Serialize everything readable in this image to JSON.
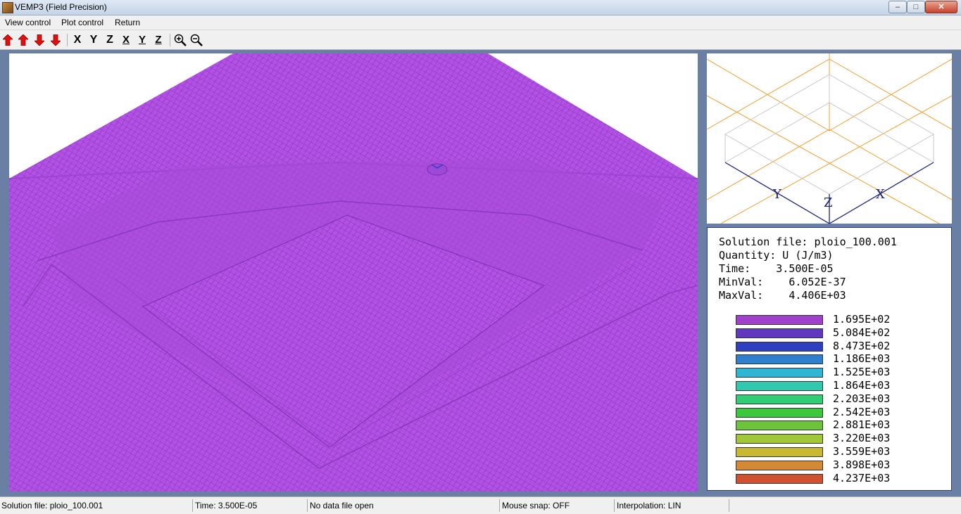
{
  "window": {
    "title": "VEMP3 (Field Precision)",
    "controls": [
      "–",
      "□",
      "✕"
    ]
  },
  "menu": {
    "items": [
      "View control",
      "Plot control",
      "Return"
    ]
  },
  "toolbar": {
    "arrows": [
      "up-arrow-icon",
      "up-arrow-icon",
      "down-arrow-icon",
      "down-arrow-icon"
    ],
    "axis_letters": [
      "X",
      "Y",
      "Z"
    ],
    "axis_sub_letters": [
      "X",
      "Y",
      "Z"
    ],
    "zoom_icons": [
      "zoom-in-icon",
      "zoom-out-icon"
    ],
    "arrow_color": "#e01010"
  },
  "orientation": {
    "axis_x": "X",
    "axis_y": "Y",
    "axis_z": "Z",
    "box_color": "#cccccc",
    "plane_color": "#f0a030",
    "axis_color": "#1a237e"
  },
  "info": {
    "solution_file": "Solution file: ploio_100.001",
    "quantity": "Quantity: U (J/m3)",
    "time": "Time:    3.500E-05",
    "min_val": "MinVal:    6.052E-37",
    "max_val": "MaxVal:    4.406E+03"
  },
  "legend": [
    {
      "label": "1.695E+02",
      "color": "#a040cc"
    },
    {
      "label": "5.084E+02",
      "color": "#6038c0"
    },
    {
      "label": "8.473E+02",
      "color": "#2e3fc0"
    },
    {
      "label": "1.186E+03",
      "color": "#2f7fd0"
    },
    {
      "label": "1.525E+03",
      "color": "#2fb6d4"
    },
    {
      "label": "1.864E+03",
      "color": "#2fc9b0"
    },
    {
      "label": "2.203E+03",
      "color": "#33cc77"
    },
    {
      "label": "2.542E+03",
      "color": "#3cc83c"
    },
    {
      "label": "2.881E+03",
      "color": "#6cc43a"
    },
    {
      "label": "3.220E+03",
      "color": "#a2c83a"
    },
    {
      "label": "3.559E+03",
      "color": "#c8b832"
    },
    {
      "label": "3.898E+03",
      "color": "#d48a34"
    },
    {
      "label": "4.237E+03",
      "color": "#d05030"
    }
  ],
  "status": {
    "solution_file": "Solution file: ploio_100.001",
    "time": "Time:   3.500E-05",
    "data_file": "No data file open",
    "mouse_snap": "Mouse snap: OFF",
    "interpolation": "Interpolation: LIN"
  },
  "colors": {
    "mesh_fill": "#b452e6",
    "mesh_line": "#7a2fb0",
    "background": "#6a7fa4"
  }
}
